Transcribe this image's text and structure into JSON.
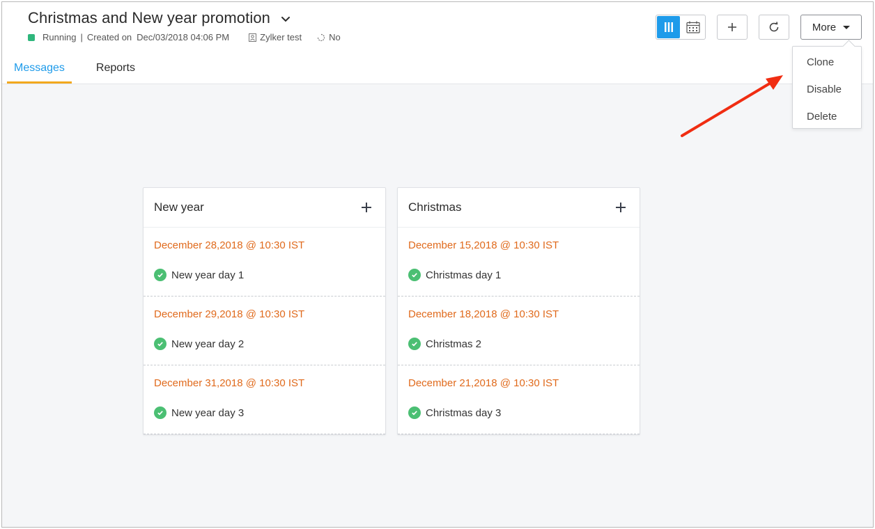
{
  "header": {
    "title": "Christmas and New year promotion",
    "status": "Running",
    "created_prefix": "Created on",
    "separator": "|",
    "created_date": "Dec/03/2018 04:06 PM",
    "owner": "Zylker test",
    "recurring": "No",
    "status_color": "#2fb67c"
  },
  "toolbar": {
    "view_columns_icon": "columns-icon",
    "view_calendar_icon": "calendar-icon",
    "add_icon": "plus-icon",
    "refresh_icon": "refresh-icon",
    "more_label": "More"
  },
  "tabs": [
    {
      "label": "Messages",
      "active": true
    },
    {
      "label": "Reports",
      "active": false
    }
  ],
  "more_menu": {
    "items": [
      {
        "label": "Clone"
      },
      {
        "label": "Disable"
      },
      {
        "label": "Delete"
      }
    ]
  },
  "annotation": {
    "arrow_color": "#f02d12"
  },
  "columns": [
    {
      "title": "New year",
      "messages": [
        {
          "date": "December 28,2018 @ 10:30 IST",
          "name": "New year day 1"
        },
        {
          "date": "December 29,2018 @ 10:30 IST",
          "name": "New year day 2"
        },
        {
          "date": "December 31,2018 @ 10:30 IST",
          "name": "New year day 3"
        }
      ]
    },
    {
      "title": "Christmas",
      "messages": [
        {
          "date": "December 15,2018 @ 10:30 IST",
          "name": "Christmas day 1"
        },
        {
          "date": "December 18,2018 @ 10:30 IST",
          "name": "Christmas 2"
        },
        {
          "date": "December 21,2018 @ 10:30 IST",
          "name": "Christmas day 3"
        }
      ]
    }
  ],
  "colors": {
    "accent": "#1e9bea",
    "tab_underline": "#f2a81d",
    "date_text": "#e06a1c",
    "check": "#4bbf73"
  }
}
